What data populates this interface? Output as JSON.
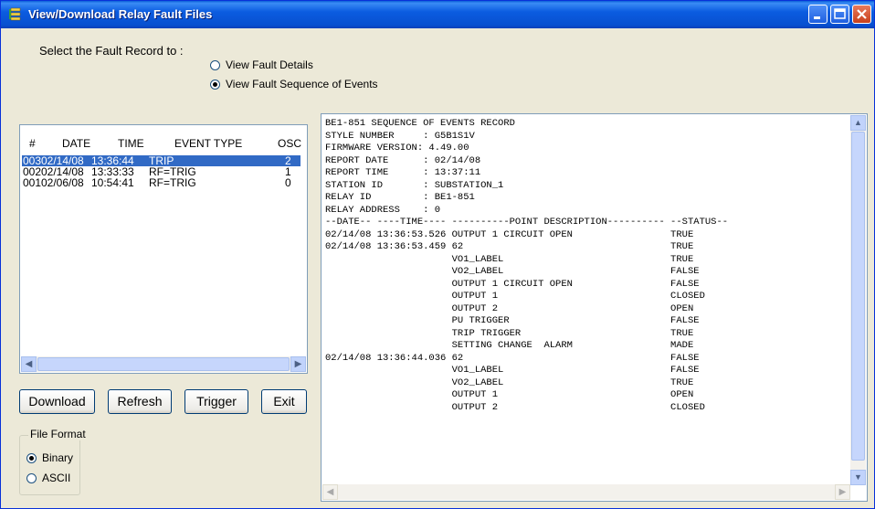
{
  "window": {
    "title": "View/Download Relay Fault Files"
  },
  "select": {
    "prompt": "Select the Fault Record to :",
    "option_details": "View Fault Details",
    "option_sequence": "View Fault Sequence of Events",
    "selected": "View Fault Sequence of Events"
  },
  "list": {
    "headers": [
      "#",
      "DATE",
      "TIME",
      "EVENT TYPE",
      "OSC"
    ],
    "rows": [
      {
        "num": "003",
        "date": "02/14/08",
        "time": "13:36:44",
        "event": "TRIP",
        "osc": "2"
      },
      {
        "num": "002",
        "date": "02/14/08",
        "time": "13:33:33",
        "event": "RF=TRIG",
        "osc": "1"
      },
      {
        "num": "001",
        "date": "02/06/08",
        "time": "10:54:41",
        "event": "RF=TRIG",
        "osc": "0"
      }
    ],
    "selected_index": 0
  },
  "buttons": {
    "download": "Download",
    "refresh": "Refresh",
    "trigger": "Trigger",
    "exit": "Exit"
  },
  "file_format": {
    "legend": "File Format",
    "binary": "Binary",
    "ascii": "ASCII",
    "selected": "Binary"
  },
  "report": {
    "lines": [
      "BE1-851 SEQUENCE OF EVENTS RECORD",
      "STYLE NUMBER     : G5B1S1V",
      "FIRMWARE VERSION: 4.49.00",
      "REPORT DATE      : 02/14/08",
      "REPORT TIME      : 13:37:11",
      "STATION ID       : SUBSTATION_1",
      "RELAY ID         : BE1-851",
      "RELAY ADDRESS    : 0",
      "--DATE-- ----TIME---- ----------POINT DESCRIPTION---------- --STATUS--",
      "02/14/08 13:36:53.526 OUTPUT 1 CIRCUIT OPEN                 TRUE",
      "02/14/08 13:36:53.459 62                                    TRUE",
      "                      VO1_LABEL                             TRUE",
      "                      VO2_LABEL                             FALSE",
      "                      OUTPUT 1 CIRCUIT OPEN                 FALSE",
      "                      OUTPUT 1                              CLOSED",
      "                      OUTPUT 2                              OPEN",
      "                      PU TRIGGER                            FALSE",
      "                      TRIP TRIGGER                          TRUE",
      "                      SETTING CHANGE  ALARM                 MADE",
      "02/14/08 13:36:44.036 62                                    FALSE",
      "                      VO1_LABEL                             FALSE",
      "                      VO2_LABEL                             TRUE",
      "                      OUTPUT 1                              OPEN",
      "                      OUTPUT 2                              CLOSED"
    ]
  },
  "colors": {
    "titlebar": "#0b5ce0",
    "selection": "#316ac5",
    "window_bg": "#ece9d8"
  }
}
